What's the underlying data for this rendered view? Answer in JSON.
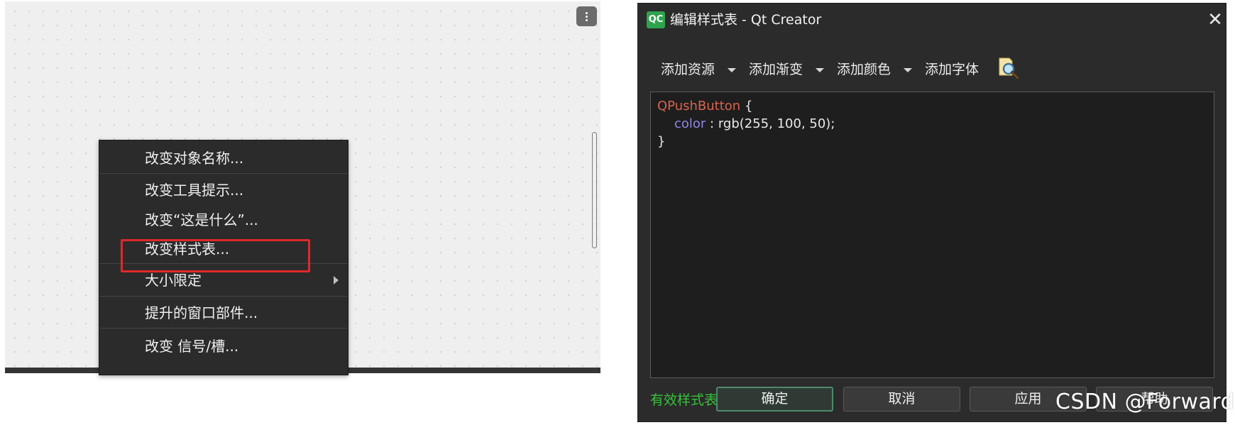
{
  "designer": {
    "context_menu": {
      "items": [
        {
          "label": "改变对象名称..."
        },
        {
          "label": "改变工具提示..."
        },
        {
          "label": "改变“这是什么”..."
        },
        {
          "label": "改变样式表...",
          "highlighted": true
        },
        {
          "label": "大小限定",
          "submenu": true
        },
        {
          "label": "提升的窗口部件..."
        },
        {
          "label": "改变 信号/槽..."
        }
      ]
    },
    "menu_icon": "more-vertical-icon"
  },
  "dialog": {
    "logo_text": "QC",
    "title": "编辑样式表 - Qt Creator",
    "close_icon": "close-icon",
    "toolbar": {
      "add_resource": "添加资源",
      "add_gradient": "添加渐变",
      "add_color": "添加颜色",
      "add_font": "添加字体",
      "find_icon": "magnifier-icon"
    },
    "editor": {
      "selector": "QPushButton",
      "open_brace": "{",
      "property": "color",
      "colon": " : ",
      "value": "rgb(255, 100, 50);",
      "close_brace": "}"
    },
    "status": "有效样式表",
    "buttons": {
      "ok": "确定",
      "cancel": "取消",
      "apply": "应用",
      "help": "帮助"
    }
  },
  "watermark": "CSDN @Forward",
  "colors": {
    "highlight_border": "#e0282c",
    "valid_status": "#35c23a",
    "selector": "#d9634e",
    "property": "#8f86e6"
  }
}
